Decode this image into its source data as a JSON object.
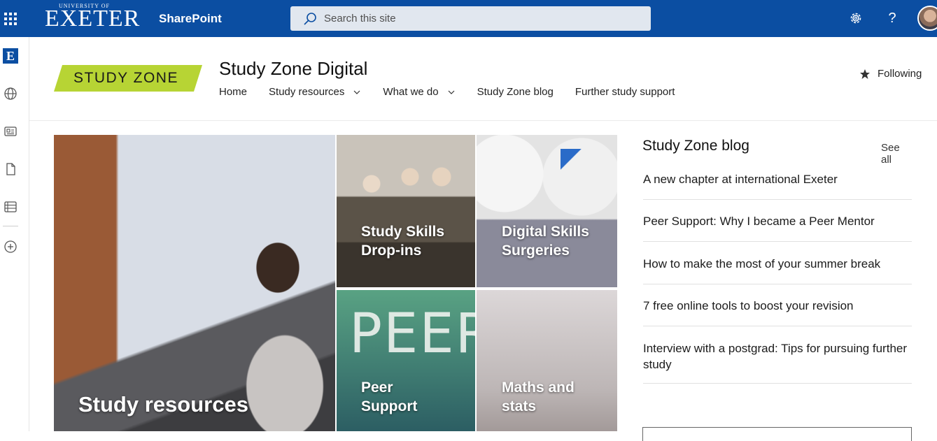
{
  "suite": {
    "logo_small": "UNIVERSITY OF",
    "logo_big": "EXETER",
    "app_title": "SharePoint",
    "search_placeholder": "Search this site"
  },
  "site": {
    "logo_text": "STUDY ZONE",
    "title": "Study Zone Digital",
    "follow_label": "Following",
    "nav": [
      {
        "label": "Home",
        "has_menu": false
      },
      {
        "label": "Study resources",
        "has_menu": true
      },
      {
        "label": "What we do",
        "has_menu": true
      },
      {
        "label": "Study Zone blog",
        "has_menu": false
      },
      {
        "label": "Further study support",
        "has_menu": false
      }
    ]
  },
  "rail": {
    "logo_letter": "E"
  },
  "hero": {
    "tiles": [
      {
        "label": "Study resources"
      },
      {
        "label_line1": "Study Skills",
        "label_line2": "Drop-ins"
      },
      {
        "label_line1": "Digital Skills",
        "label_line2": "Surgeries"
      },
      {
        "label_line1": "Peer",
        "label_line2": "Support",
        "watermark": "PEER"
      },
      {
        "label_line1": "Maths and",
        "label_line2": "stats"
      }
    ]
  },
  "news": {
    "title": "Study Zone blog",
    "see_all": "See all",
    "items": [
      "A new chapter at international Exeter",
      "Peer Support: Why I became a Peer Mentor",
      "How to make the most of your summer break",
      "7 free online tools to boost your revision",
      "Interview with a postgrad: Tips for pursuing further study"
    ]
  }
}
